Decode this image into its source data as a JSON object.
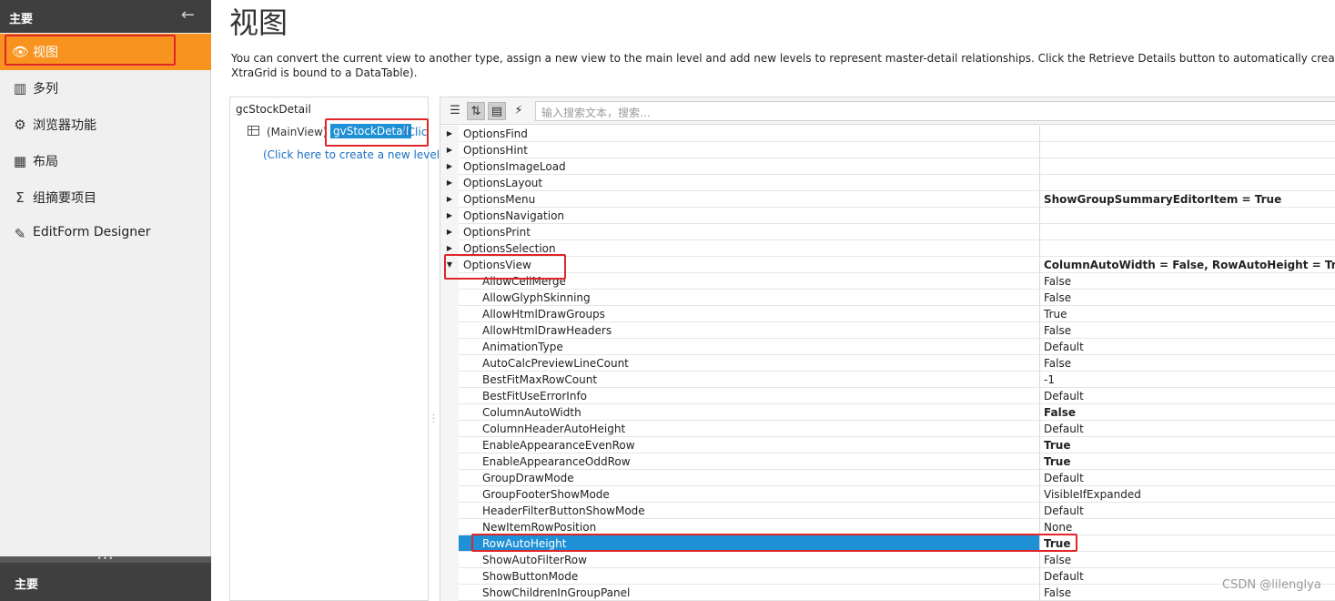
{
  "sidebar": {
    "header": "主要",
    "items": [
      {
        "label": "视图",
        "icon": "eye-icon",
        "glyph": "👁"
      },
      {
        "label": "多列",
        "icon": "columns-icon",
        "glyph": "▥"
      },
      {
        "label": "浏览器功能",
        "icon": "gear-icon",
        "glyph": "⚙"
      },
      {
        "label": "布局",
        "icon": "layout-icon",
        "glyph": "▦"
      },
      {
        "label": "组摘要项目",
        "icon": "sigma-icon",
        "glyph": "Σ"
      },
      {
        "label": "EditForm Designer",
        "icon": "edit-icon",
        "glyph": "✎"
      }
    ],
    "footer": "主要"
  },
  "main": {
    "title": "视图",
    "description_line1": "You can convert the current view to another type, assign a new view to the main level and add new levels to represent master-detail relationships. Click the Retrieve Details button to automatically create levels for all the maste",
    "description_line2": "XtraGrid is bound to a DataTable)."
  },
  "tree": {
    "root": "gcStockDetail",
    "main_view_label": "(MainView)",
    "selected_view": "gvStockDetail",
    "click_prefix": "(Click",
    "create_level": "(Click here to create a new level)"
  },
  "property_grid": {
    "search_placeholder": "输入搜索文本，搜索…",
    "rows": [
      {
        "name": "OptionsFind",
        "value": "",
        "expander": "right",
        "child": false,
        "bold": false
      },
      {
        "name": "OptionsHint",
        "value": "",
        "expander": "right",
        "child": false,
        "bold": false
      },
      {
        "name": "OptionsImageLoad",
        "value": "",
        "expander": "right",
        "child": false,
        "bold": false
      },
      {
        "name": "OptionsLayout",
        "value": "",
        "expander": "right",
        "child": false,
        "bold": false
      },
      {
        "name": "OptionsMenu",
        "value": "ShowGroupSummaryEditorItem = True",
        "expander": "right",
        "child": false,
        "bold": true
      },
      {
        "name": "OptionsNavigation",
        "value": "",
        "expander": "right",
        "child": false,
        "bold": false
      },
      {
        "name": "OptionsPrint",
        "value": "",
        "expander": "right",
        "child": false,
        "bold": false
      },
      {
        "name": "OptionsSelection",
        "value": "",
        "expander": "right",
        "child": false,
        "bold": false
      },
      {
        "name": "OptionsView",
        "value": "ColumnAutoWidth = False, RowAutoHeight = True,",
        "expander": "down",
        "child": false,
        "bold": true
      },
      {
        "name": "AllowCellMerge",
        "value": "False",
        "expander": "",
        "child": true,
        "bold": false
      },
      {
        "name": "AllowGlyphSkinning",
        "value": "False",
        "expander": "",
        "child": true,
        "bold": false
      },
      {
        "name": "AllowHtmlDrawGroups",
        "value": "True",
        "expander": "",
        "child": true,
        "bold": false
      },
      {
        "name": "AllowHtmlDrawHeaders",
        "value": "False",
        "expander": "",
        "child": true,
        "bold": false
      },
      {
        "name": "AnimationType",
        "value": "Default",
        "expander": "",
        "child": true,
        "bold": false
      },
      {
        "name": "AutoCalcPreviewLineCount",
        "value": "False",
        "expander": "",
        "child": true,
        "bold": false
      },
      {
        "name": "BestFitMaxRowCount",
        "value": "-1",
        "expander": "",
        "child": true,
        "bold": false
      },
      {
        "name": "BestFitUseErrorInfo",
        "value": "Default",
        "expander": "",
        "child": true,
        "bold": false
      },
      {
        "name": "ColumnAutoWidth",
        "value": "False",
        "expander": "",
        "child": true,
        "bold": true
      },
      {
        "name": "ColumnHeaderAutoHeight",
        "value": "Default",
        "expander": "",
        "child": true,
        "bold": false
      },
      {
        "name": "EnableAppearanceEvenRow",
        "value": "True",
        "expander": "",
        "child": true,
        "bold": true
      },
      {
        "name": "EnableAppearanceOddRow",
        "value": "True",
        "expander": "",
        "child": true,
        "bold": true
      },
      {
        "name": "GroupDrawMode",
        "value": "Default",
        "expander": "",
        "child": true,
        "bold": false
      },
      {
        "name": "GroupFooterShowMode",
        "value": "VisibleIfExpanded",
        "expander": "",
        "child": true,
        "bold": false
      },
      {
        "name": "HeaderFilterButtonShowMode",
        "value": "Default",
        "expander": "",
        "child": true,
        "bold": false
      },
      {
        "name": "NewItemRowPosition",
        "value": "None",
        "expander": "",
        "child": true,
        "bold": false
      },
      {
        "name": "RowAutoHeight",
        "value": "True",
        "expander": "",
        "child": true,
        "bold": true,
        "selected": true
      },
      {
        "name": "ShowAutoFilterRow",
        "value": "False",
        "expander": "",
        "child": true,
        "bold": false
      },
      {
        "name": "ShowButtonMode",
        "value": "Default",
        "expander": "",
        "child": true,
        "bold": false
      },
      {
        "name": "ShowChildrenInGroupPanel",
        "value": "False",
        "expander": "",
        "child": true,
        "bold": false
      }
    ]
  },
  "watermark": "CSDN @lilenglya",
  "colors": {
    "accent": "#f7931e",
    "selection": "#1e90d5",
    "highlight_box": "#e0262b",
    "sidebar_dark": "#3f3f3f"
  }
}
